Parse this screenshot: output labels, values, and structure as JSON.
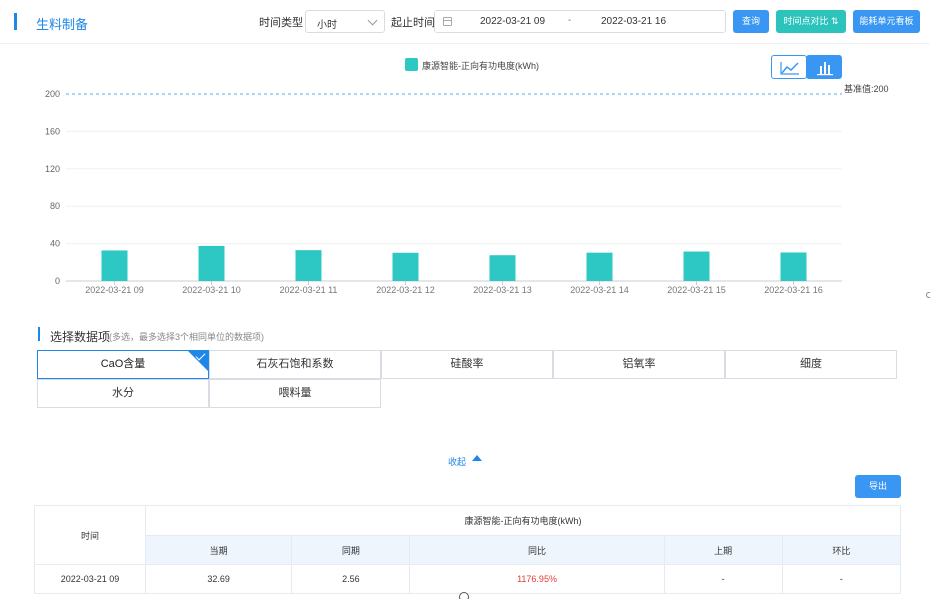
{
  "header": {
    "title": "生料制备",
    "time_type_label": "时间类型：",
    "time_type_value": "小时",
    "range_label": "起止时间：",
    "range_start": "2022-03-21 09",
    "range_sep": "-",
    "range_end": "2022-03-21 16",
    "query_button": "查询",
    "compare_button": "时间点对比",
    "board_button": "能耗单元看板"
  },
  "chart_controls": {
    "line_icon": "line-chart-icon",
    "bar_icon": "bar-chart-icon"
  },
  "chart_data": {
    "type": "bar",
    "title": "",
    "series": [
      {
        "name": "康源智能-正向有功电度(kWh)",
        "color": "#2ec8c4",
        "values": [
          32.69,
          37.5,
          33.0,
          30.2,
          27.6,
          30.3,
          31.5,
          30.5
        ]
      }
    ],
    "categories": [
      "2022-03-21 09",
      "2022-03-21 10",
      "2022-03-21 11",
      "2022-03-21 12",
      "2022-03-21 13",
      "2022-03-21 14",
      "2022-03-21 15",
      "2022-03-21 16"
    ],
    "yticks": [
      0,
      40,
      80,
      120,
      160,
      200
    ],
    "ylim": [
      0,
      200
    ],
    "grid": true,
    "legend": "top-center",
    "reference_line": {
      "value": 200,
      "label": "基准值:200",
      "color": "#46b7e5"
    }
  },
  "data_items": {
    "title": "选择数据项",
    "hint": "(多选，最多选择3个相同单位的数据项)",
    "items": [
      {
        "label": "CaO含量",
        "selected": true
      },
      {
        "label": "石灰石饱和系数",
        "selected": false
      },
      {
        "label": "硅酸率",
        "selected": false
      },
      {
        "label": "铝氧率",
        "selected": false
      },
      {
        "label": "细度",
        "selected": false
      },
      {
        "label": "水分",
        "selected": false
      },
      {
        "label": "喂料量",
        "selected": false
      }
    ],
    "collapse_label": "收起"
  },
  "export_button": "导出",
  "table": {
    "time_header": "时间",
    "group_header": "康源智能-正向有功电度(kWh)",
    "sub_headers": [
      "当期",
      "同期",
      "同比",
      "上期",
      "环比"
    ],
    "rows": [
      {
        "time": "2022-03-21 09",
        "current": "32.69",
        "same_period": "2.56",
        "yoy": "1176.95%",
        "previous": "-",
        "mom": "-"
      }
    ]
  },
  "colors": {
    "accent": "#1f87e8",
    "button_blue": "#3a96f3",
    "button_teal": "#2bc3bb",
    "bar": "#2ec8c4",
    "negative": "#e33b3b"
  }
}
